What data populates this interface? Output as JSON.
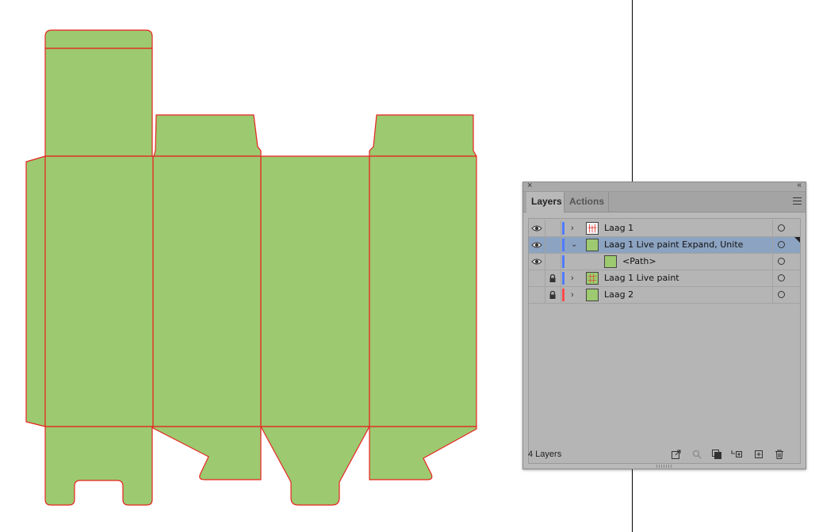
{
  "panel": {
    "close": "×",
    "collapse": "‹‹",
    "tabs": [
      {
        "label": "Layers",
        "active": true
      },
      {
        "label": "Actions",
        "active": false
      }
    ],
    "layers": [
      {
        "label": "Laag 1",
        "visible": true,
        "locked": false,
        "expandable": true,
        "expanded": false,
        "color": "#4f7bff",
        "selected": false,
        "thumb": "red-lines"
      },
      {
        "label": "Laag 1 Live paint Expand, Unite",
        "visible": true,
        "locked": false,
        "expandable": true,
        "expanded": true,
        "color": "#4f7bff",
        "selected": true,
        "thumb": "green"
      },
      {
        "label": "<Path>",
        "visible": true,
        "locked": false,
        "expandable": false,
        "expanded": false,
        "color": "#4f7bff",
        "selected": false,
        "thumb": "green"
      },
      {
        "label": "Laag 1 Live paint",
        "visible": false,
        "locked": true,
        "expandable": true,
        "expanded": false,
        "color": "#4f7bff",
        "selected": false,
        "thumb": "green-red"
      },
      {
        "label": "Laag 2",
        "visible": false,
        "locked": true,
        "expandable": true,
        "expanded": false,
        "color": "#ff4a4a",
        "selected": false,
        "thumb": "green"
      }
    ],
    "footer": {
      "count": "4 Layers",
      "icons": [
        "export-icon",
        "locate-object-icon",
        "make-clipping-mask-icon",
        "create-sublayer-icon",
        "new-layer-icon",
        "trash-icon"
      ]
    }
  },
  "artwork": {
    "fill": "#9dc970",
    "stroke": "#e8231f"
  }
}
